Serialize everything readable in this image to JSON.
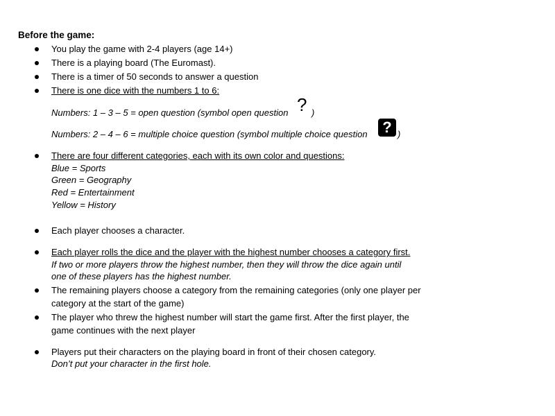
{
  "heading": "Before the game:",
  "items": {
    "players": "You play the game with 2-4 players (age 14+)",
    "board": "There is a playing board (The Euromast).",
    "timer": "There is a timer of 50 seconds to answer a question",
    "dice": "There is one dice with the numbers 1 to 6:",
    "open_question": "Numbers: 1 – 3 – 5 = open question (symbol open question",
    "multiple_choice": "Numbers: 2 – 4 – 6 = multiple choice question (symbol multiple choice question",
    "categories_intro": "There are four different categories, each with its own color and questions:",
    "cat_blue": "Blue = Sports",
    "cat_green": "Green = Geography",
    "cat_red": "Red = Entertainment",
    "cat_yellow": "Yellow = History",
    "character": "Each player chooses a character.",
    "roll": "Each player rolls the dice and the player with the highest number chooses a category first.",
    "roll_tie_1": "If two or more players throw the highest number, then they will throw the dice again until",
    "roll_tie_2": "one of these players has the highest number.",
    "remaining_1": "The remaining players choose a category from the remaining categories (only one player per",
    "remaining_2": "category at the start of the game)",
    "first_1": "The player who threw the highest number will start the game first. After the first player, the",
    "first_2": "game continues with the next player",
    "place_1": "Players put their characters on the playing board in front of their chosen category.",
    "place_2": "Don’t put your character in the first hole."
  },
  "symbols": {
    "open_glyph": "?",
    "mc_glyph": "?",
    "close_paren": ")"
  }
}
